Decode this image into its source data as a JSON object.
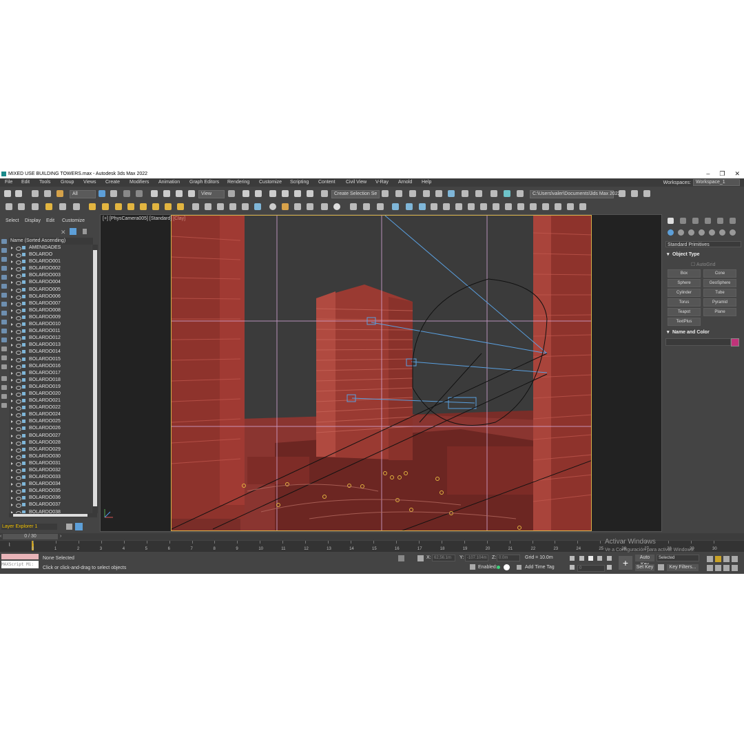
{
  "window": {
    "title": "MIXED USE BUILDING TOWERS.max - Autodesk 3ds Max 2022",
    "minimize": "–",
    "maximize": "❐",
    "close": "✕"
  },
  "menu": [
    "File",
    "Edit",
    "Tools",
    "Group",
    "Views",
    "Create",
    "Modifiers",
    "Animation",
    "Graph Editors",
    "Rendering",
    "Customize",
    "Scripting",
    "Content",
    "Civil View",
    "V-Ray",
    "Arnold",
    "Help"
  ],
  "workspace": {
    "label": "Workspaces:",
    "value": "Workspace_1"
  },
  "toolbar": {
    "filter": "All",
    "ref_coord": "View",
    "selection_set": "Create Selection Se",
    "project_path": "C:\\Users\\valer\\Documents\\3ds Max 2022"
  },
  "scene_explorer": {
    "menu": [
      "Select",
      "Display",
      "Edit",
      "Customize"
    ],
    "column_header": "Name (Sorted Ascending)",
    "items": [
      "AMENIDADES",
      "BOLARDO",
      "BOLARDO001",
      "BOLARDO002",
      "BOLARDO003",
      "BOLARDO004",
      "BOLARDO005",
      "BOLARDO006",
      "BOLARDO007",
      "BOLARDO008",
      "BOLARDO009",
      "BOLARDO010",
      "BOLARDO011",
      "BOLARDO012",
      "BOLARDO013",
      "BOLARDO014",
      "BOLARDO015",
      "BOLARDO016",
      "BOLARDO017",
      "BOLARDO018",
      "BOLARDO019",
      "BOLARDO020",
      "BOLARDO021",
      "BOLARDO022",
      "BOLARDO024",
      "BOLARDO025",
      "BOLARDO026",
      "BOLARDO027",
      "BOLARDO028",
      "BOLARDO029",
      "BOLARDO030",
      "BOLARDO031",
      "BOLARDO032",
      "BOLARDO033",
      "BOLARDO034",
      "BOLARDO035",
      "BOLARDO036",
      "BOLARDO037",
      "BOLARDO038"
    ],
    "layer_explorer": "Layer Explorer 1"
  },
  "viewport": {
    "plus": "[+]",
    "camera": "[PhysCamera005]",
    "shading": "[Standard]",
    "style": "[Clay]"
  },
  "command_panel": {
    "category": "Standard Primitives",
    "object_type_title": "Object Type",
    "autogrid": "AutoGrid",
    "buttons": [
      "Box",
      "Cone",
      "Sphere",
      "GeoSphere",
      "Cylinder",
      "Tube",
      "Torus",
      "Pyramid",
      "Teapot",
      "Plane",
      "TextPlus"
    ],
    "name_color_title": "Name and Color",
    "color": "#c0337a"
  },
  "timeline": {
    "frame": "0 / 30",
    "ticks": [
      "0",
      "1",
      "2",
      "3",
      "4",
      "5",
      "6",
      "7",
      "8",
      "9",
      "10",
      "11",
      "12",
      "13",
      "14",
      "15",
      "16",
      "17",
      "18",
      "19",
      "20",
      "21",
      "22",
      "23",
      "24",
      "25",
      "26",
      "27",
      "28",
      "29",
      "30"
    ]
  },
  "status": {
    "selection": "None Selected",
    "prompt": "Click or click-and-drag to select objects",
    "maxscript": "MAXScript Mi:",
    "x_label": "X:",
    "x": "62,56.1m",
    "y_label": "Y:",
    "y": "-107.104m",
    "z_label": "Z:",
    "z": "0.0m",
    "grid": "Grid = 10.0m",
    "enabled": "Enabled:",
    "add_time_tag": "Add Time Tag",
    "auto_key": "Auto Key",
    "set_key": "Set Key",
    "key_mode": "Selected",
    "key_filters": "Key Filters...",
    "frame_field": "0"
  },
  "watermark": {
    "line1": "Activar Windows",
    "line2": "Ve a Configuración para activar Windows."
  }
}
